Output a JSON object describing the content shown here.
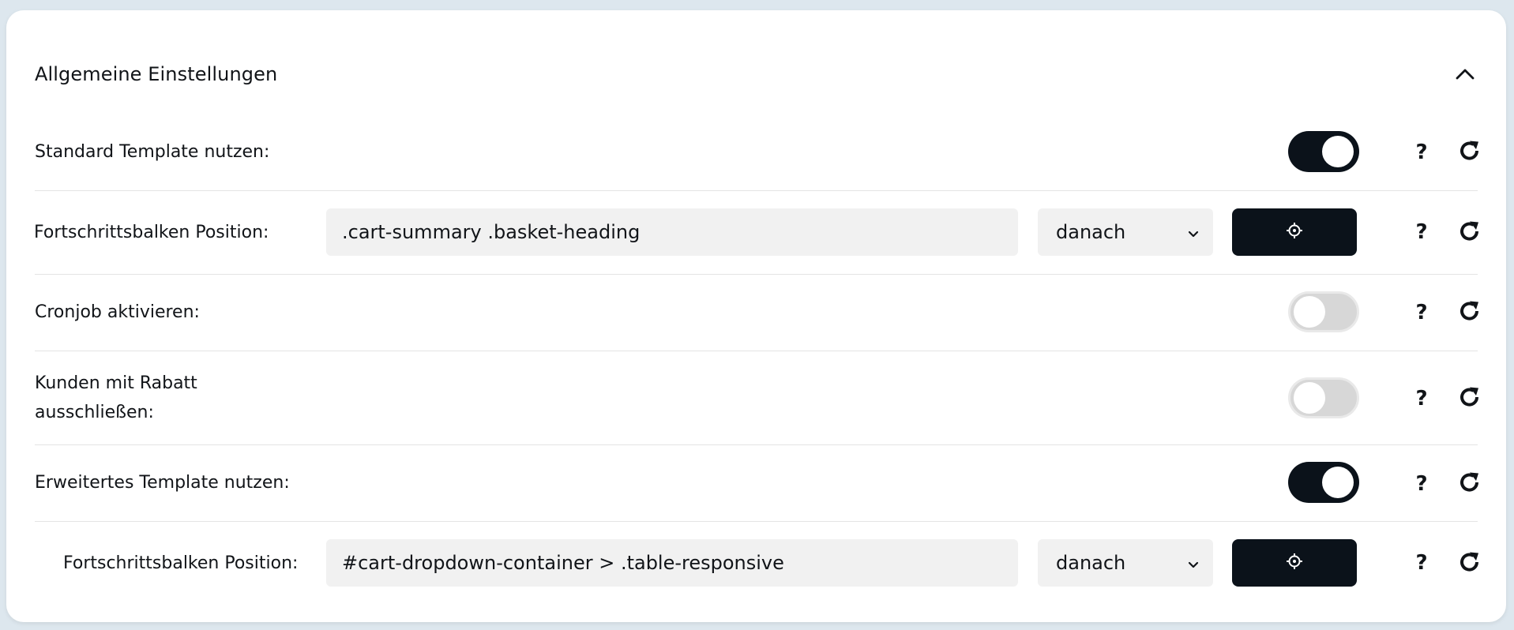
{
  "section": {
    "title": "Allgemeine Einstellungen",
    "collapse_icon": "chevron-up-icon"
  },
  "settings": [
    {
      "label": "Standard Template nutzen:",
      "type": "toggle",
      "enabled": true,
      "help": "?",
      "reset_icon": "reset-icon"
    },
    {
      "label": "Fortschrittsbalken Position:",
      "type": "selector",
      "value": ".cart-summary .basket-heading",
      "placement": "danach",
      "picker_icon": "crosshair-icon",
      "help": "?",
      "reset_icon": "reset-icon"
    },
    {
      "label": "Cronjob aktivieren:",
      "type": "toggle",
      "enabled": false,
      "help": "?",
      "reset_icon": "reset-icon"
    },
    {
      "label": "Kunden mit Rabatt ausschließen:",
      "label_line1": "Kunden mit Rabatt",
      "label_line2": "ausschließen:",
      "type": "toggle",
      "enabled": false,
      "help": "?",
      "reset_icon": "reset-icon"
    },
    {
      "label": "Erweitertes Template nutzen:",
      "type": "toggle",
      "enabled": true,
      "help": "?",
      "reset_icon": "reset-icon"
    },
    {
      "label": "Fortschrittsbalken Position:",
      "type": "selector",
      "value": "#cart-dropdown-container > .table-responsive",
      "placement": "danach",
      "picker_icon": "crosshair-icon",
      "help": "?",
      "reset_icon": "reset-icon"
    }
  ],
  "colors": {
    "accent": "#0b121a",
    "input_bg": "#f1f1f1",
    "toggle_off": "#d7d7d7",
    "page_bg": "#dde7ee"
  }
}
